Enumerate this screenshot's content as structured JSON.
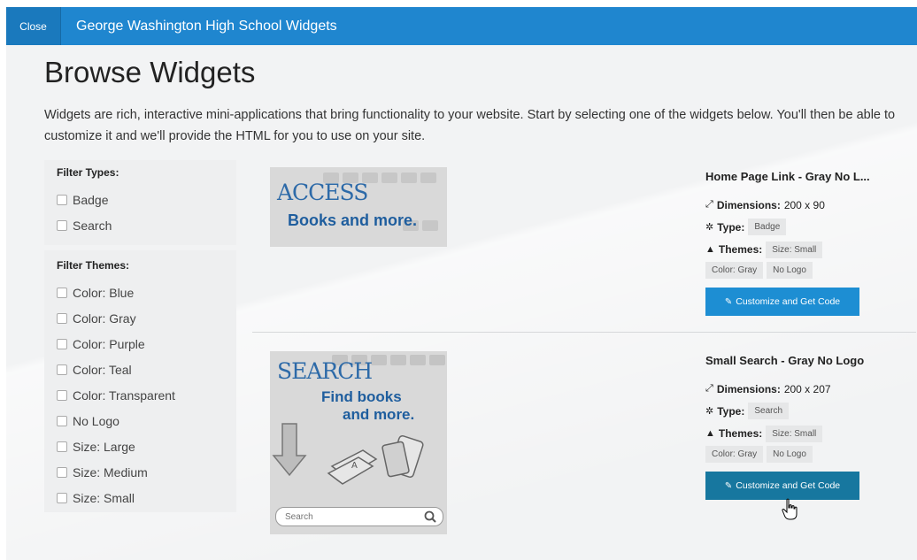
{
  "topbar": {
    "close_label": "Close",
    "title": "George Washington High School Widgets"
  },
  "page": {
    "title": "Browse Widgets",
    "intro": "Widgets are rich, interactive mini-applications that bring functionality to your website. Start by selecting one of the widgets below. You'll then be able to customize it and we'll provide the HTML for you to use on your site."
  },
  "filters": {
    "types_heading": "Filter Types:",
    "types": [
      "Badge",
      "Search"
    ],
    "themes_heading": "Filter Themes:",
    "themes": [
      "Color: Blue",
      "Color: Gray",
      "Color: Purple",
      "Color: Teal",
      "Color: Transparent",
      "No Logo",
      "Size: Large",
      "Size: Medium",
      "Size: Small"
    ]
  },
  "widgets": [
    {
      "title": "Home Page Link - Gray No L...",
      "dimensions_label": "Dimensions:",
      "dimensions": "200 x 90",
      "type_label": "Type:",
      "type": "Badge",
      "themes_label": "Themes:",
      "themes": [
        "Size: Small",
        "Color: Gray",
        "No Logo"
      ],
      "button": "Customize and Get Code",
      "thumb_heading": "ACCESS",
      "thumb_sub": "Books and more."
    },
    {
      "title": "Small Search - Gray No Logo",
      "dimensions_label": "Dimensions:",
      "dimensions": "200 x 207",
      "type_label": "Type:",
      "type": "Search",
      "themes_label": "Themes:",
      "themes": [
        "Size: Small",
        "Color: Gray",
        "No Logo"
      ],
      "button": "Customize and Get Code",
      "thumb_heading": "SEARCH",
      "thumb_sub1": "Find books",
      "thumb_sub2": "and more.",
      "search_placeholder": "Search"
    }
  ],
  "colors": {
    "topbar": "#1f86cf",
    "button": "#1d8ed3",
    "button_hover": "#17779f"
  }
}
